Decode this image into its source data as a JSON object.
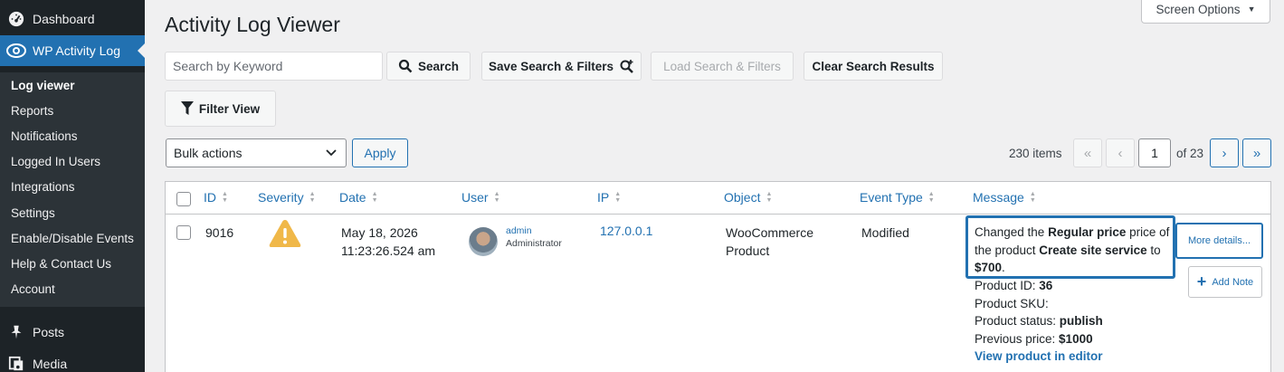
{
  "sidebar": {
    "dashboard_label": "Dashboard",
    "plugin_label": "WP Activity Log",
    "submenu": [
      "Log viewer",
      "Reports",
      "Notifications",
      "Logged In Users",
      "Integrations",
      "Settings",
      "Enable/Disable Events",
      "Help & Contact Us",
      "Account"
    ],
    "posts_label": "Posts",
    "media_label": "Media"
  },
  "header": {
    "title": "Activity Log Viewer",
    "screen_options": "Screen Options"
  },
  "toolbar": {
    "search_placeholder": "Search by Keyword",
    "search_label": "Search",
    "save_label": "Save Search & Filters",
    "load_label": "Load Search & Filters",
    "clear_label": "Clear Search Results",
    "filter_label": "Filter View"
  },
  "bulk": {
    "selected": "Bulk actions",
    "apply_label": "Apply"
  },
  "pagination": {
    "items": "230 items",
    "first": "«",
    "prev": "‹",
    "current": "1",
    "of_pages": "of 23",
    "next": "›",
    "last": "»"
  },
  "table": {
    "columns": [
      "ID",
      "Severity",
      "Date",
      "User",
      "IP",
      "Object",
      "Event Type",
      "Message"
    ],
    "row": {
      "id": "9016",
      "severity_icon": "warning-icon",
      "date_line1": "May 18, 2026",
      "date_line2": "11:23:26.524 am",
      "user_name": "admin",
      "user_role": "Administrator",
      "ip": "127.0.0.1",
      "object_line1": "WooCommerce",
      "object_line2": "Product",
      "event_type": "Modified",
      "message": {
        "p1": "Changed the ",
        "b1": "Regular price",
        "p2": " price of the product ",
        "b2": "Create site service",
        "p3": " to ",
        "b3": "$700",
        "p4": "."
      },
      "details": {
        "product_id_label": "Product ID: ",
        "product_id": "36",
        "product_sku_label": "Product SKU:",
        "status_label": "Product status: ",
        "status": "publish",
        "prev_price_label": "Previous price: ",
        "prev_price": "$1000",
        "link": "View product in editor"
      },
      "more_details": "More details...",
      "add_note": "Add Note"
    }
  },
  "colors": {
    "accent": "#2271b1",
    "sidebar_bg": "#1d2327",
    "warning": "#f0b849"
  }
}
